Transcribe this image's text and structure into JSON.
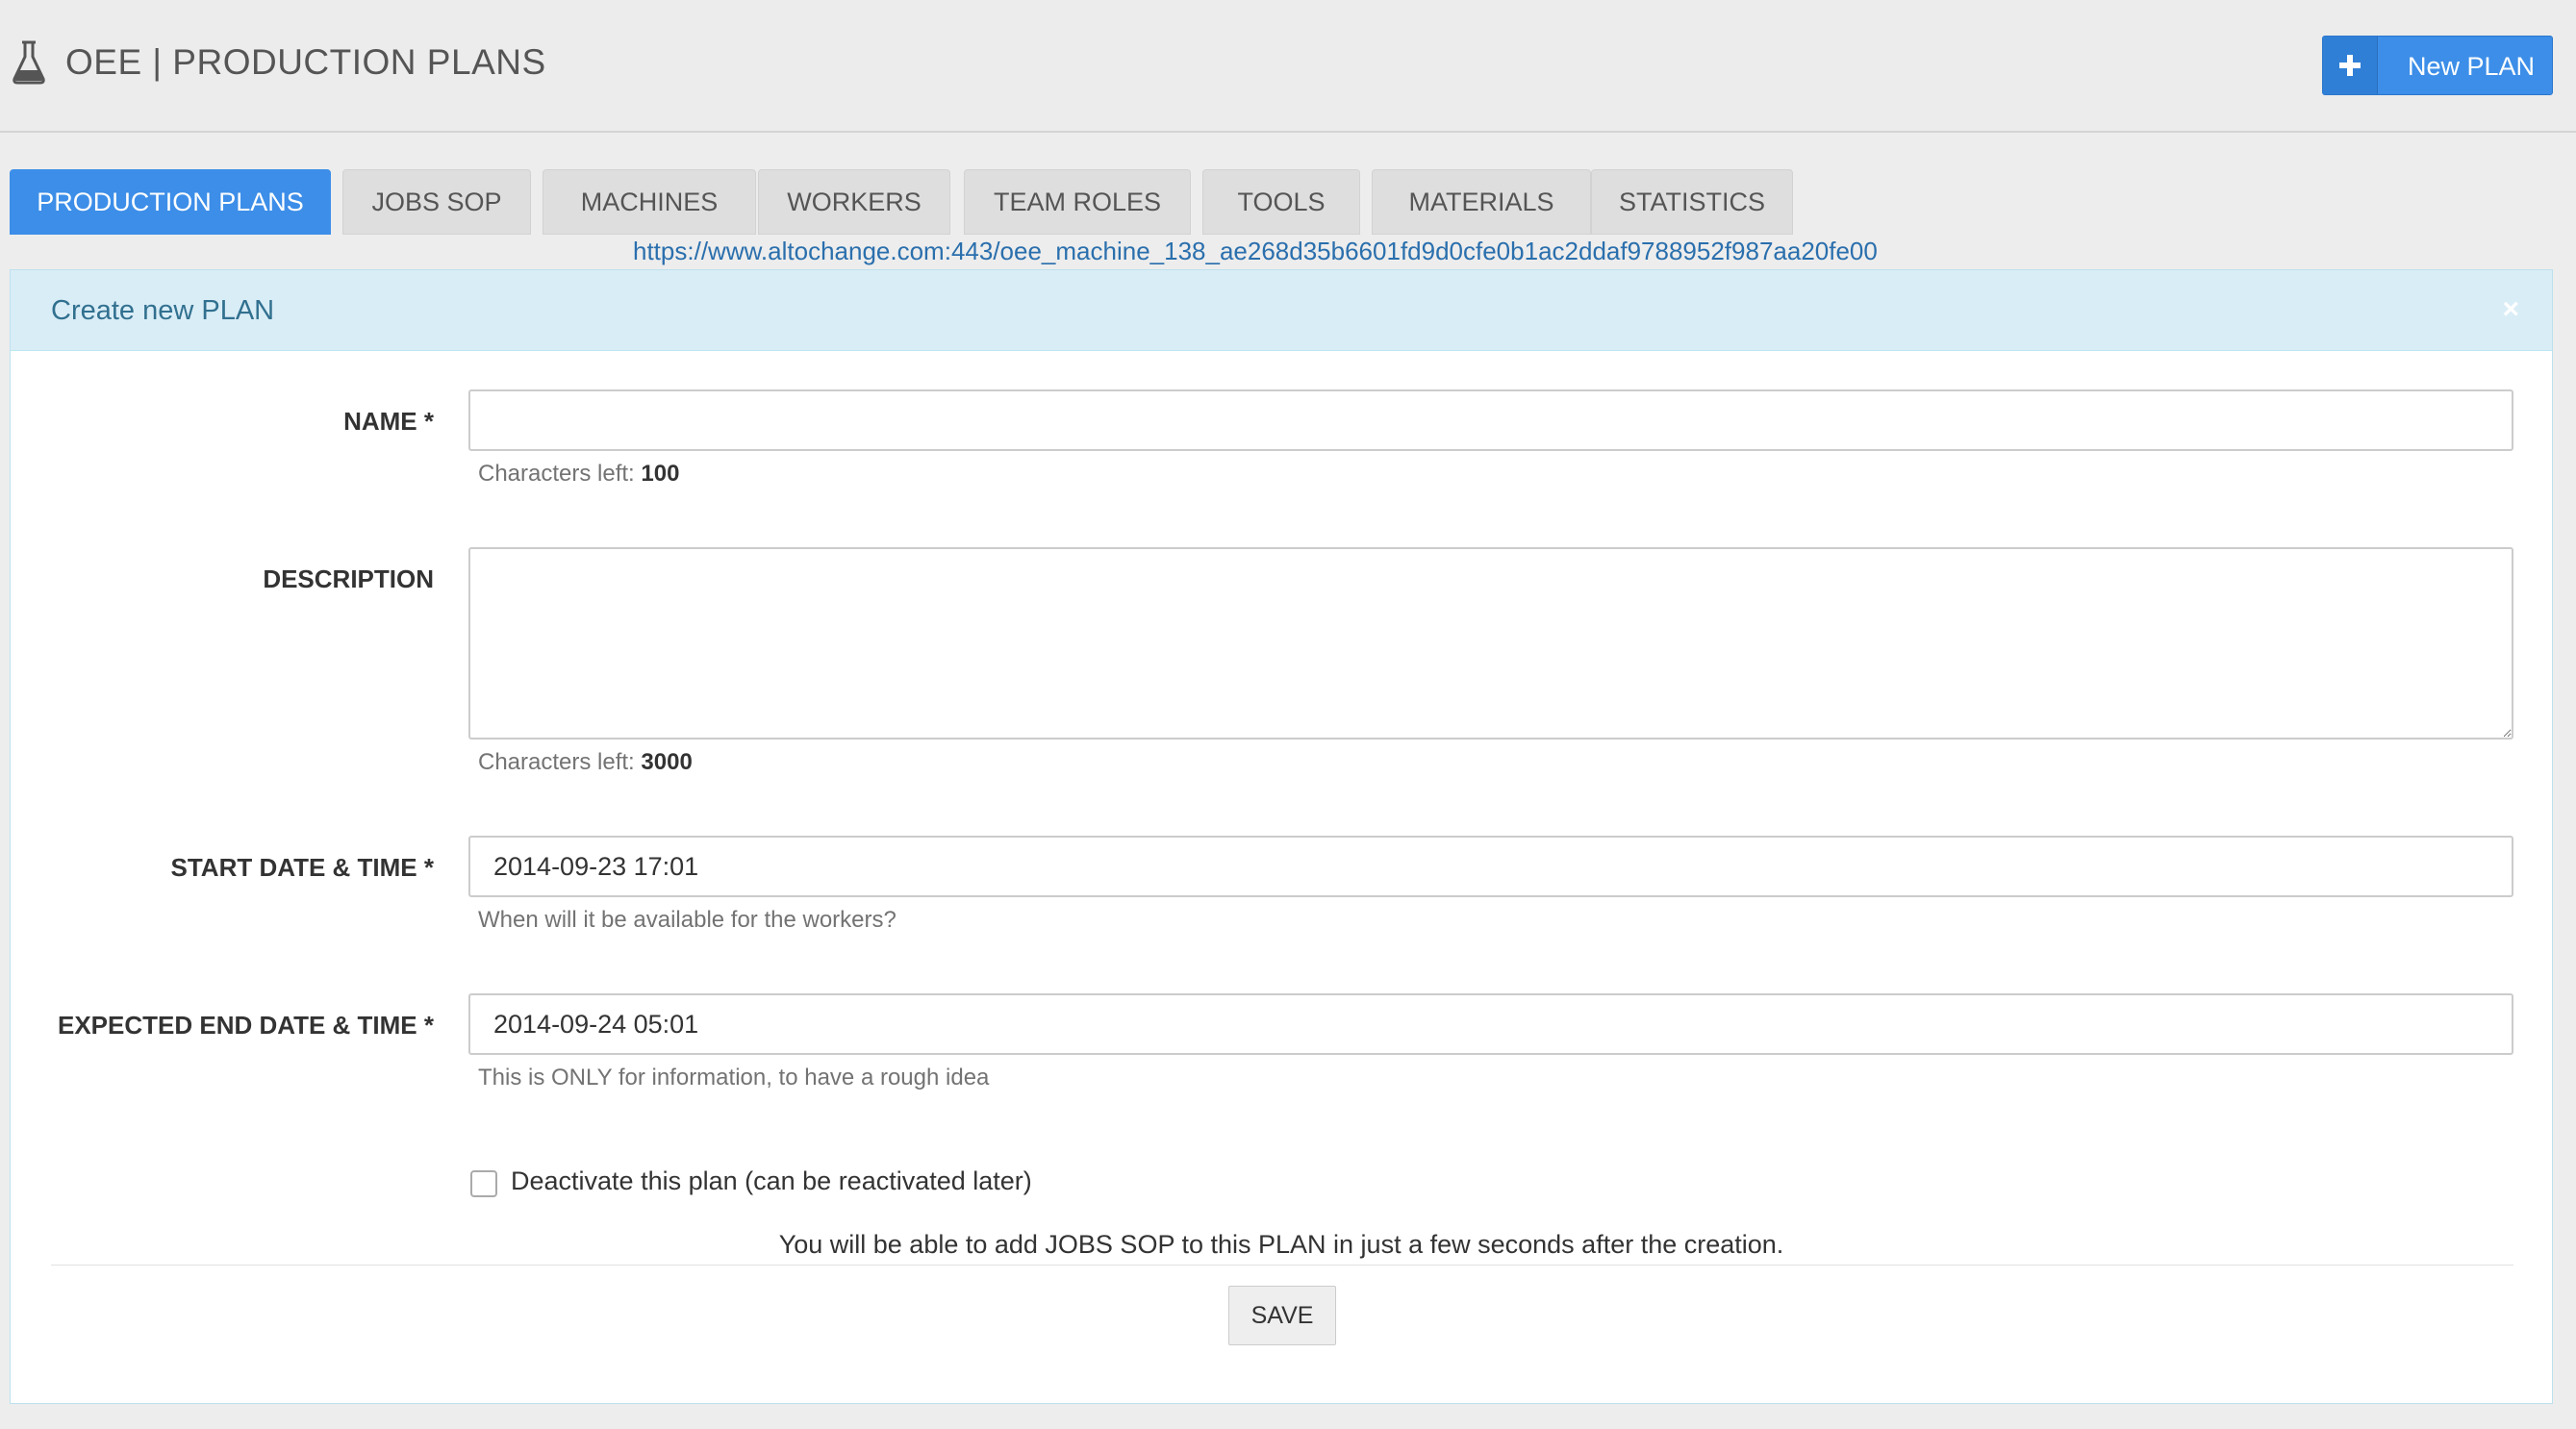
{
  "header": {
    "icon": "flask-icon",
    "title": "OEE | PRODUCTION PLANS",
    "new_plan_button": {
      "icon": "plus-icon",
      "label": "New PLAN"
    }
  },
  "tabs": [
    {
      "label": "PRODUCTION PLANS",
      "active": true
    },
    {
      "label": "JOBS SOP",
      "active": false
    },
    {
      "label": "MACHINES",
      "active": false
    },
    {
      "label": "WORKERS",
      "active": false
    },
    {
      "label": "TEAM ROLES",
      "active": false
    },
    {
      "label": "TOOLS",
      "active": false
    },
    {
      "label": "MATERIALS",
      "active": false
    },
    {
      "label": "STATISTICS",
      "active": false
    }
  ],
  "url_link": "https://www.altochange.com:443/oee_machine_138_ae268d35b6601fd9d0cfe0b1ac2ddaf9788952f987aa20fe00",
  "panel": {
    "title": "Create new PLAN",
    "close": "×"
  },
  "form": {
    "name": {
      "label": "NAME *",
      "value": "",
      "help_prefix": "Characters left: ",
      "help_count": "100"
    },
    "description": {
      "label": "DESCRIPTION",
      "value": "",
      "help_prefix": "Characters left: ",
      "help_count": "3000"
    },
    "start": {
      "label": "START DATE & TIME *",
      "value": "2014-09-23 17:01",
      "help": "When will it be available for the workers?"
    },
    "end": {
      "label": "EXPECTED END DATE & TIME *",
      "value": "2014-09-24 05:01",
      "help": "This is ONLY for information, to have a rough idea"
    },
    "deactivate": {
      "label": "Deactivate this plan (can be reactivated later)",
      "checked": false
    },
    "notice": "You will be able to add JOBS SOP to this PLAN in just a few seconds after the creation.",
    "save_label": "SAVE"
  },
  "colors": {
    "accent": "#3c8ee8",
    "panel_header": "#d9edf7",
    "panel_title": "#31708f",
    "link": "#2a6fad"
  }
}
